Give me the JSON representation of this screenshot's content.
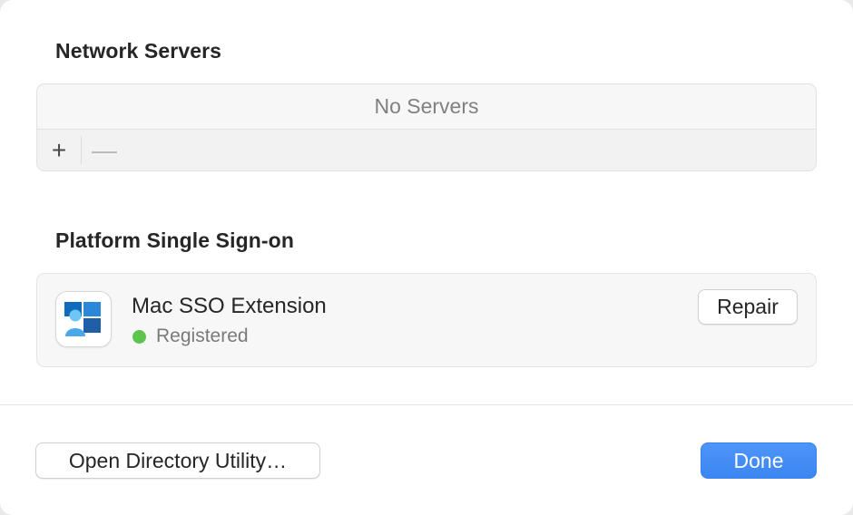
{
  "network_servers": {
    "title": "Network Servers",
    "empty_text": "No Servers",
    "add_label": "+",
    "remove_label": "—"
  },
  "platform_sso": {
    "title": "Platform Single Sign-on",
    "extension": {
      "name": "Mac SSO Extension",
      "icon": "company-portal-icon",
      "status": "Registered",
      "status_color": "#5ec44d",
      "repair_label": "Repair"
    }
  },
  "footer": {
    "open_directory_label": "Open Directory Utility…",
    "done_label": "Done",
    "accent_color": "#3b86f2"
  }
}
